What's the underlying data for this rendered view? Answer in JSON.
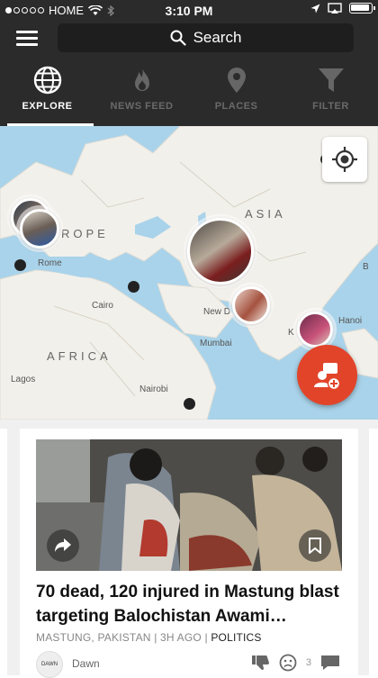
{
  "status_bar": {
    "carrier": "HOME",
    "time": "3:10 PM"
  },
  "top_bar": {
    "search_label": "Search"
  },
  "tabs": [
    {
      "label": "EXPLORE",
      "icon": "globe-icon",
      "active": true
    },
    {
      "label": "NEWS FEED",
      "icon": "flame-icon",
      "active": false
    },
    {
      "label": "PLACES",
      "icon": "map-pin-icon",
      "active": false
    },
    {
      "label": "FILTER",
      "icon": "funnel-icon",
      "active": false
    }
  ],
  "map": {
    "regions": {
      "asia": "ASIA",
      "europe": "ROPE",
      "africa": "AFRICA"
    },
    "cities": {
      "rome": "Rome",
      "cairo": "Cairo",
      "new_delhi": "New D",
      "mumbai": "Mumbai",
      "nairobi": "Nairobi",
      "lagos": "Lagos",
      "hanoi": "Hanoi",
      "b": "B",
      "k": "K"
    }
  },
  "article": {
    "headline": "70 dead, 120 injured in Mastung blast targeting Balochistan Awami…",
    "location": "MASTUNG, PAKISTAN",
    "age": "3H AGO",
    "category": "POLITICS",
    "source": "Dawn",
    "reaction_count": "3"
  },
  "colors": {
    "bar": "#2b2b2b",
    "accent": "#e2442a",
    "water": "#a9d3ea",
    "land": "#f2f0ea"
  }
}
